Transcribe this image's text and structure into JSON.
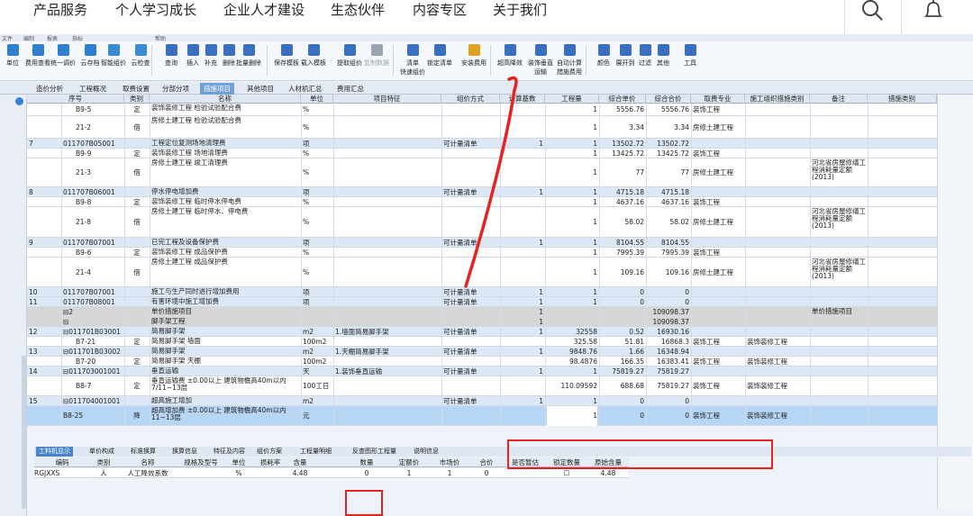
{
  "topnav": {
    "items": [
      "产品服务",
      "个人学习成长",
      "企业人才建设",
      "生态伙伴",
      "内容专区",
      "关于我们"
    ],
    "icons": [
      "search-icon",
      "bell-icon"
    ]
  },
  "menubar": [
    "文件",
    "编制",
    "报表",
    "指标",
    "帮助"
  ],
  "toolbar": [
    {
      "label": "单位",
      "color": "#2f7fd0"
    },
    {
      "label": "费用查看",
      "color": "#2f7fd0"
    },
    {
      "label": "统一调价",
      "color": "#2f7fd0"
    },
    {
      "label": "云存档",
      "color": "#2f7fd0"
    },
    {
      "label": "智能组价",
      "color": "#3a8ad4"
    },
    {
      "label": "云检查",
      "color": "#3a8ad4"
    },
    {
      "label": "查询",
      "color": "#3b6fc2"
    },
    {
      "label": "插入",
      "color": "#3b6fc2"
    },
    {
      "label": "补充",
      "color": "#3b6fc2"
    },
    {
      "label": "删除",
      "color": "#3b6fc2"
    },
    {
      "label": "批量删除",
      "color": "#3b6fc2"
    },
    {
      "label": "保存模板",
      "color": "#3b6fc2"
    },
    {
      "label": "载入模板",
      "color": "#3b6fc2"
    },
    {
      "label": "提取组价",
      "color": "#3b6fc2"
    },
    {
      "label": "复制数据",
      "color": "#9aa4b0",
      "disabled": true
    },
    {
      "label": "清单",
      "label2": "快速组价",
      "color": "#3b6fc2"
    },
    {
      "label": "锁定清单",
      "color": "#3b6fc2"
    },
    {
      "label": "安装费用",
      "color": "#e0a020"
    },
    {
      "label": "超高降效",
      "color": "#3b6fc2"
    },
    {
      "label": "装饰垂直",
      "label2": "运输",
      "color": "#3b6fc2"
    },
    {
      "label": "自动计算",
      "label2": "措施费用",
      "color": "#3b6fc2"
    },
    {
      "label": "颜色",
      "color": "#3b6fc2"
    },
    {
      "label": "展开到",
      "color": "#3b6fc2"
    },
    {
      "label": "过滤",
      "color": "#3b6fc2"
    },
    {
      "label": "其他",
      "color": "#3b6fc2"
    },
    {
      "label": "工具",
      "color": "#3b6fc2"
    }
  ],
  "tabs": [
    "造价分析",
    "工程概况",
    "取费设置",
    "分部分项",
    "措施项目",
    "其他项目",
    "人材机汇总",
    "费用汇总"
  ],
  "active_tab": "措施项目",
  "grid": {
    "columns": [
      "序号",
      "类别",
      "名称",
      "单位",
      "项目特征",
      "组价方式",
      "计算基数",
      "工程量",
      "综合单价",
      "综合合价",
      "取费专业",
      "施工组织措施类别",
      "备注",
      "措施类别"
    ],
    "rows": [
      {
        "type": "sub",
        "h": 14,
        "seq": "",
        "code": "B9-5",
        "cat": "定",
        "name": "装饰装修工程 检验试验配合费",
        "unit": "%",
        "feat": "",
        "method": "",
        "base": "",
        "qty": "1",
        "price": "5556.76",
        "total": "5556.76",
        "spec": "装饰工程",
        "org": "",
        "remark": "",
        "mtype": ""
      },
      {
        "type": "sub",
        "h": 25,
        "seq": "",
        "code": "21-2",
        "cat": "借",
        "name": "房修土建工程 检验试验配合费",
        "unit": "%",
        "feat": "",
        "method": "",
        "base": "",
        "qty": "1",
        "price": "3.34",
        "total": "3.34",
        "spec": "房修土建工程",
        "org": "",
        "remark": "",
        "mtype": ""
      },
      {
        "type": "list",
        "h": 11,
        "seq": "7",
        "code": "011707B05001",
        "cat": "",
        "name": "工程定位复测场地清理费",
        "unit": "项",
        "feat": "",
        "method": "可计量清单",
        "base": "1",
        "qty": "1",
        "price": "13502.72",
        "total": "13502.72",
        "spec": "",
        "org": "",
        "remark": "",
        "mtype": ""
      },
      {
        "type": "sub",
        "h": 11,
        "seq": "",
        "code": "B9-9",
        "cat": "定",
        "name": "装饰装修工程 场地清理费",
        "unit": "%",
        "feat": "",
        "method": "",
        "base": "",
        "qty": "1",
        "price": "13425.72",
        "total": "13425.72",
        "spec": "装饰工程",
        "org": "",
        "remark": "",
        "mtype": ""
      },
      {
        "type": "sub",
        "h": 32,
        "seq": "",
        "code": "21-3",
        "cat": "借",
        "name": "房修土建工程 竣工清理费",
        "unit": "%",
        "feat": "",
        "method": "",
        "base": "",
        "qty": "1",
        "price": "77",
        "total": "77",
        "spec": "房修土建工程",
        "org": "",
        "remark": "河北省房屋修缮工程消耗量定额(2013)",
        "mtype": ""
      },
      {
        "type": "list",
        "h": 11,
        "seq": "8",
        "code": "011707B06001",
        "cat": "",
        "name": "停水停电增加费",
        "unit": "项",
        "feat": "",
        "method": "可计量清单",
        "base": "1",
        "qty": "1",
        "price": "4715.18",
        "total": "4715.18",
        "spec": "",
        "org": "",
        "remark": "",
        "mtype": ""
      },
      {
        "type": "sub",
        "h": 11,
        "seq": "",
        "code": "B9-8",
        "cat": "定",
        "name": "装饰装修工程 临时停水停电费",
        "unit": "%",
        "feat": "",
        "method": "",
        "base": "",
        "qty": "1",
        "price": "4637.16",
        "total": "4637.16",
        "spec": "装饰工程",
        "org": "",
        "remark": "",
        "mtype": ""
      },
      {
        "type": "sub",
        "h": 34,
        "seq": "",
        "code": "21-8",
        "cat": "借",
        "name": "房修土建工程 临时停水、停电费",
        "unit": "%",
        "feat": "",
        "method": "",
        "base": "",
        "qty": "1",
        "price": "58.02",
        "total": "58.02",
        "spec": "房修土建工程",
        "org": "",
        "remark": "河北省房屋修缮工程消耗量定额(2013)",
        "mtype": ""
      },
      {
        "type": "list",
        "h": 11,
        "seq": "9",
        "code": "011707B07001",
        "cat": "",
        "name": "已完工程及设备保护费",
        "unit": "项",
        "feat": "",
        "method": "可计量清单",
        "base": "1",
        "qty": "1",
        "price": "8104.55",
        "total": "8104.55",
        "spec": "",
        "org": "",
        "remark": "",
        "mtype": ""
      },
      {
        "type": "sub",
        "h": 11,
        "seq": "",
        "code": "B9-6",
        "cat": "定",
        "name": "装饰装修工程 成品保护费",
        "unit": "%",
        "feat": "",
        "method": "",
        "base": "",
        "qty": "1",
        "price": "7995.39",
        "total": "7995.39",
        "spec": "装饰工程",
        "org": "",
        "remark": "",
        "mtype": ""
      },
      {
        "type": "sub",
        "h": 33,
        "seq": "",
        "code": "21-4",
        "cat": "借",
        "name": "房修土建工程 成品保护费",
        "unit": "%",
        "feat": "",
        "method": "",
        "base": "",
        "qty": "1",
        "price": "109.16",
        "total": "109.16",
        "spec": "房修土建工程",
        "org": "",
        "remark": "河北省房屋修缮工程消耗量定额(2013)",
        "mtype": ""
      },
      {
        "type": "list",
        "h": 11,
        "seq": "10",
        "code": "011707B07001",
        "cat": "",
        "name": "施工与生产同时进行增加费用",
        "unit": "项",
        "feat": "",
        "method": "可计量清单",
        "base": "1",
        "qty": "1",
        "price": "0",
        "total": "0",
        "spec": "",
        "org": "",
        "remark": "",
        "mtype": ""
      },
      {
        "type": "list",
        "h": 11,
        "seq": "11",
        "code": "011707B08001",
        "cat": "",
        "name": "有害环境中施工增加费",
        "unit": "项",
        "feat": "",
        "method": "可计量清单",
        "base": "1",
        "qty": "1",
        "price": "0",
        "total": "0",
        "spec": "",
        "org": "",
        "remark": "",
        "mtype": ""
      },
      {
        "type": "sum",
        "h": 11,
        "seq": "",
        "code": "⊟2",
        "cat": "",
        "name": "单价措施项目",
        "unit": "",
        "feat": "",
        "method": "",
        "base": "1",
        "qty": "",
        "price": "",
        "total": "109098.37",
        "spec": "",
        "org": "",
        "remark": "单价措施项目",
        "mtype": ""
      },
      {
        "type": "sum",
        "h": 11,
        "seq": "",
        "code": "⊟",
        "cat": "",
        "name": "脚手架工程",
        "unit": "",
        "feat": "",
        "method": "",
        "base": "1",
        "qty": "",
        "price": "",
        "total": "109098.37",
        "spec": "",
        "org": "",
        "remark": "",
        "mtype": ""
      },
      {
        "type": "list",
        "h": 11,
        "seq": "12",
        "code": "⊟011701B03001",
        "cat": "",
        "name": "简易脚手架",
        "unit": "m2",
        "feat": "1.墙面简易脚手架",
        "method": "可计量清单",
        "base": "1",
        "qty": "32558",
        "price": "0.52",
        "total": "16930.16",
        "spec": "",
        "org": "",
        "remark": "",
        "mtype": ""
      },
      {
        "type": "sub",
        "h": 11,
        "seq": "",
        "code": "B7-21",
        "cat": "定",
        "name": "简易脚手架 墙面",
        "unit": "100m2",
        "feat": "",
        "method": "",
        "base": "",
        "qty": "325.58",
        "price": "51.81",
        "total": "16868.3",
        "spec": "装饰工程",
        "org": "装饰装修工程",
        "remark": "",
        "mtype": ""
      },
      {
        "type": "list",
        "h": 11,
        "seq": "13",
        "code": "⊟011701B03002",
        "cat": "",
        "name": "简易脚手架",
        "unit": "m2",
        "feat": "1.天棚简易脚手架",
        "method": "可计量清单",
        "base": "1",
        "qty": "9848.76",
        "price": "1.66",
        "total": "16348.94",
        "spec": "",
        "org": "",
        "remark": "",
        "mtype": ""
      },
      {
        "type": "sub",
        "h": 11,
        "seq": "",
        "code": "B7-20",
        "cat": "定",
        "name": "简易脚手架 天棚",
        "unit": "100m2",
        "feat": "",
        "method": "",
        "base": "",
        "qty": "98.4876",
        "price": "166.35",
        "total": "16383.41",
        "spec": "装饰工程",
        "org": "装饰装修工程",
        "remark": "",
        "mtype": ""
      },
      {
        "type": "list",
        "h": 11,
        "seq": "14",
        "code": "⊟011703001001",
        "cat": "",
        "name": "垂直运输",
        "unit": "天",
        "feat": "1.装饰垂直运输",
        "method": "可计量清单",
        "base": "1",
        "qty": "1",
        "price": "75819.27",
        "total": "75819.27",
        "spec": "",
        "org": "",
        "remark": "",
        "mtype": ""
      },
      {
        "type": "sub",
        "h": 22,
        "seq": "",
        "code": "B8-7",
        "cat": "定",
        "name": "垂直运输费 ±0.00以上 建筑物檐高40m以内7/11~13层",
        "unit": "100工日",
        "feat": "",
        "method": "",
        "base": "",
        "qty": "110.09592",
        "price": "688.68",
        "total": "75819.27",
        "spec": "装饰工程",
        "org": "装饰装修工程",
        "remark": "",
        "mtype": ""
      },
      {
        "type": "list",
        "h": 11,
        "seq": "15",
        "code": "⊟011704001001",
        "cat": "",
        "name": "超高施工增加",
        "unit": "m2",
        "feat": "",
        "method": "可计量清单",
        "base": "1",
        "qty": "1",
        "price": "0",
        "total": "0",
        "spec": "",
        "org": "",
        "remark": "",
        "mtype": ""
      },
      {
        "type": "sel",
        "h": 22,
        "seq": "",
        "code": "B8-25",
        "cat": "降",
        "name": "超高增加费 ±0.00以上 建筑物檐高40m以内11~13层",
        "unit": "元",
        "feat": "",
        "method": "",
        "base": "",
        "qty": "1",
        "price": "0",
        "total": "0",
        "spec": "装饰工程",
        "org": "装饰装修工程",
        "remark": "",
        "mtype": ""
      }
    ]
  },
  "bottom_tabs": [
    "工料机显示",
    "单价构成",
    "标准换算",
    "换算信息",
    "特征及内容",
    "组价方案",
    "工程量明细",
    "反查图形工程量",
    "说明信息"
  ],
  "bottom_active": "工料机显示",
  "bottom_grid": {
    "columns": [
      "编码",
      "类别",
      "名称",
      "规格及型号",
      "单位",
      "损耗率",
      "含量",
      "数量",
      "定额价",
      "市场价",
      "合价",
      "是否暂估",
      "锁定数量",
      "原始含量"
    ],
    "row": [
      "RGJXXS",
      "人",
      "人工降效系数",
      "",
      "%",
      "",
      "4.48",
      "0",
      "1",
      "1",
      "0",
      "",
      "☐",
      "4.48"
    ]
  },
  "colors": {
    "annotation_red": "#e8231f",
    "list_row": "#dde8f6",
    "selected_row": "#b7d5f5",
    "active_tab": "#6fa0d8"
  }
}
